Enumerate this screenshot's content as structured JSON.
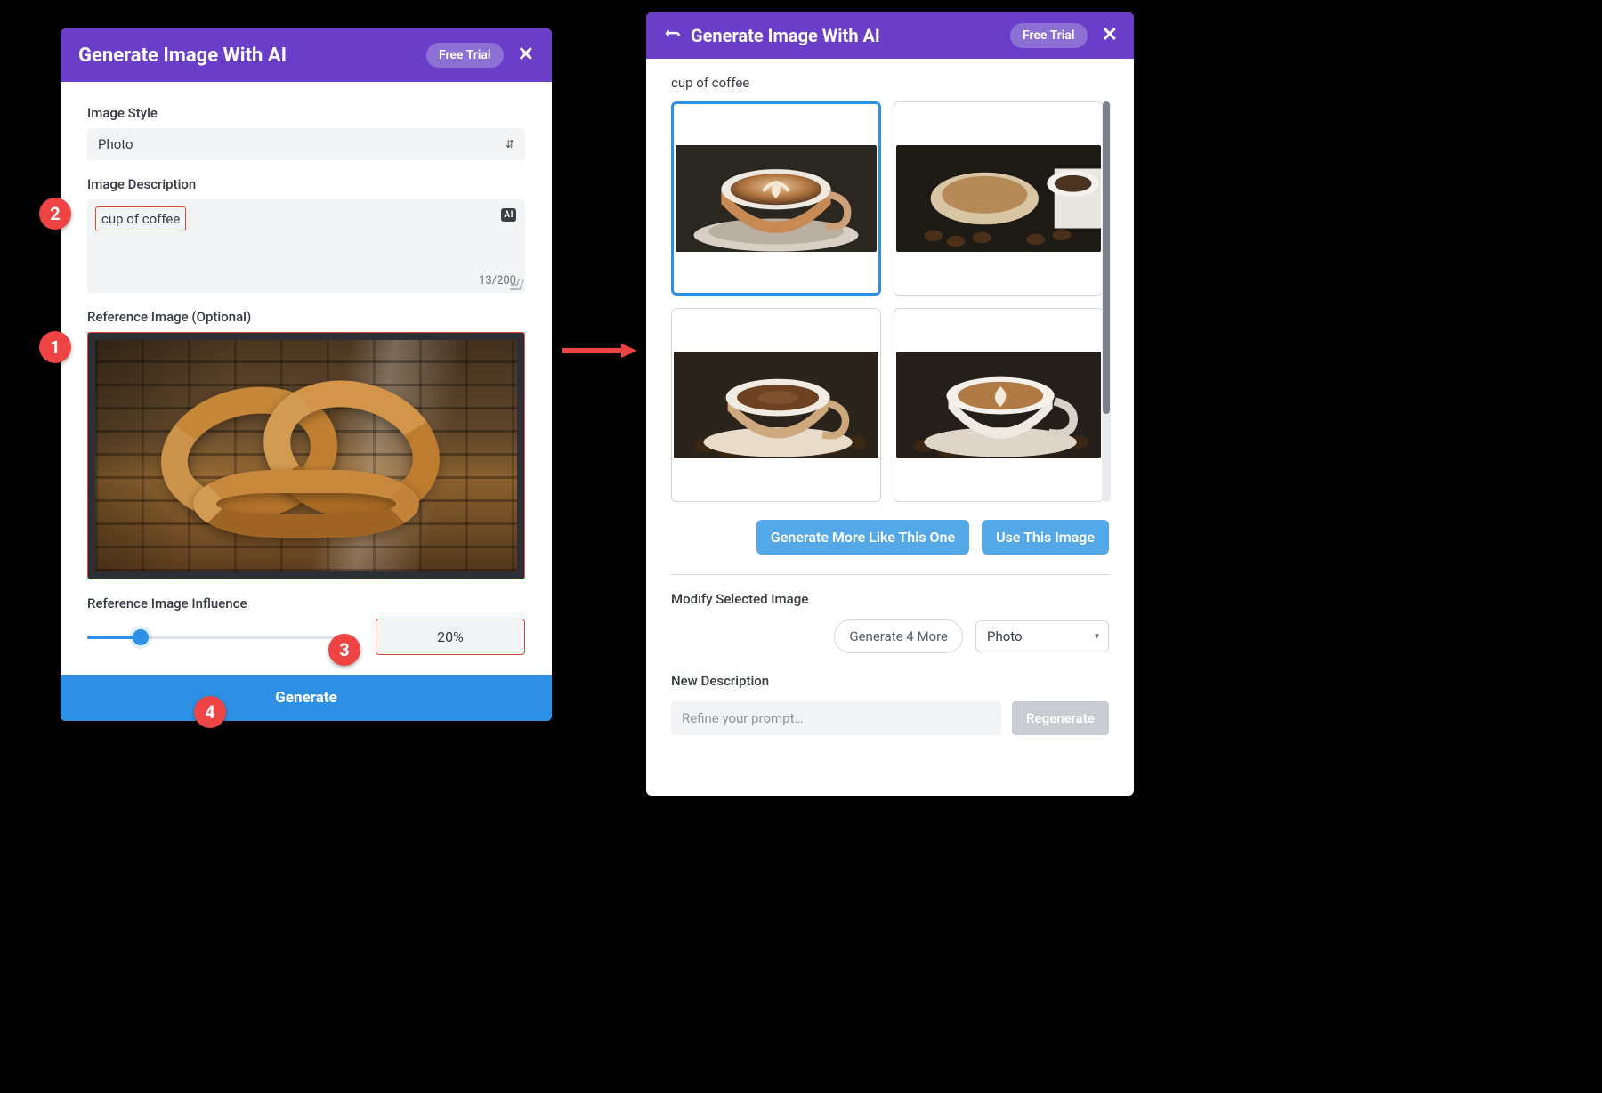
{
  "left": {
    "title": "Generate Image With AI",
    "free_trial": "Free Trial",
    "style_label": "Image Style",
    "style_value": "Photo",
    "desc_label": "Image Description",
    "desc_value": "cup of coffee",
    "ai_chip": "AI",
    "char_count": "13/200",
    "ref_label": "Reference Image (Optional)",
    "influence_label": "Reference Image Influence",
    "influence_value": "20%",
    "influence_pct": 20,
    "generate": "Generate"
  },
  "right": {
    "title": "Generate Image With AI",
    "free_trial": "Free Trial",
    "prompt": "cup of coffee",
    "more_like": "Generate More Like This One",
    "use_image": "Use This Image",
    "modify_head": "Modify Selected Image",
    "gen4": "Generate 4 More",
    "style_value": "Photo",
    "new_desc": "New Description",
    "refine_placeholder": "Refine your prompt…",
    "regenerate": "Regenerate"
  },
  "callouts": {
    "c1": "1",
    "c2": "2",
    "c3": "3",
    "c4": "4"
  }
}
